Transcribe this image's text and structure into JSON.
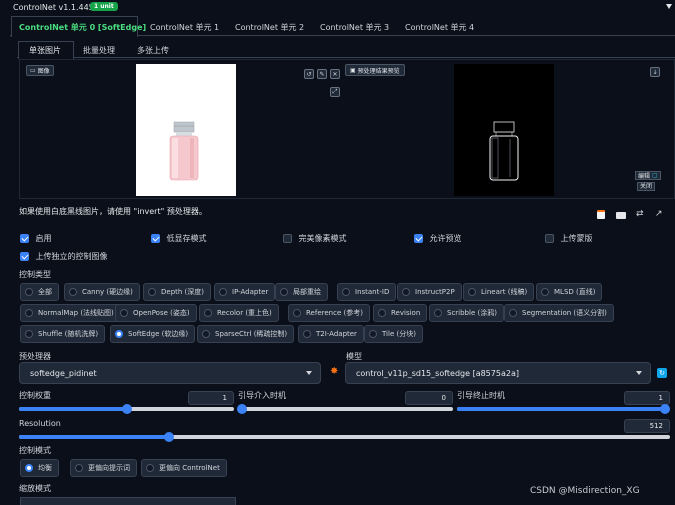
{
  "header": {
    "title": "ControlNet v1.1.445",
    "unit_badge": "1 unit",
    "collapse_icon": "triangle-down-icon"
  },
  "unit_tabs": [
    {
      "label": "ControlNet 单元 0 [SoftEdge]",
      "active": true
    },
    {
      "label": "ControlNet 单元 1",
      "active": false
    },
    {
      "label": "ControlNet 单元 2",
      "active": false
    },
    {
      "label": "ControlNet 单元 3",
      "active": false
    },
    {
      "label": "ControlNet 单元 4",
      "active": false
    }
  ],
  "image_tabs": [
    {
      "label": "单张图片",
      "active": true
    },
    {
      "label": "批量处理",
      "active": false
    },
    {
      "label": "多张上传",
      "active": false
    }
  ],
  "image_panel": {
    "image_label": "图像",
    "preview_button": "预处理结果预览",
    "edit_label": "编辑",
    "close_label": "关闭"
  },
  "hint_text": "如果使用白底黑线图片，请使用 \"invert\" 预处理器。",
  "options": {
    "enable": "启用",
    "low_vram": "低显存模式",
    "pixel_perfect": "完美像素模式",
    "allow_preview": "允许预览",
    "upload_mask": "上传蒙版",
    "independent_control": "上传独立的控制图像"
  },
  "control_type": {
    "label": "控制类型",
    "selected": "SoftEdge (软边缘)",
    "row1": [
      "全部",
      "Canny (硬边缘)",
      "Depth (深度)",
      "IP-Adapter",
      "局部重绘",
      "Instant-ID",
      "InstructP2P",
      "Lineart (线稿)",
      "MLSD (直线)"
    ],
    "row2": [
      "NormalMap (法线贴图)",
      "OpenPose (姿态)",
      "Recolor (重上色)",
      "Reference (参考)",
      "Revision",
      "Scribble (涂鸦)",
      "Segmentation (语义分割)"
    ],
    "row3": [
      "Shuffle (随机洗牌)",
      "SoftEdge (软边缘)",
      "SparseCtrl (稀疏控制)",
      "T2I-Adapter",
      "Tile (分块)"
    ]
  },
  "preprocessor": {
    "label": "预处理器",
    "value": "softedge_pidinet"
  },
  "model": {
    "label": "模型",
    "value": "control_v11p_sd15_softedge [a8575a2a]"
  },
  "weight": {
    "label": "控制权重",
    "value": "1",
    "fraction": 0.5
  },
  "start_step": {
    "label": "引导介入时机",
    "value": "0",
    "fraction": 0.0
  },
  "end_step": {
    "label": "引导终止时机",
    "value": "1",
    "fraction": 1.0
  },
  "resolution": {
    "label": "Resolution",
    "value": "512",
    "fraction": 0.23
  },
  "control_mode": {
    "label": "控制模式",
    "options": [
      "均衡",
      "更偏向提示词",
      "更偏向 ControlNet"
    ],
    "selected": "均衡"
  },
  "resize_mode": {
    "label": "缩放模式"
  },
  "watermark": "CSDN @Misdirection_XG",
  "colors": {
    "accent": "#3b82f6",
    "tab_active": "#4ade80",
    "badge": "#16a34a"
  }
}
